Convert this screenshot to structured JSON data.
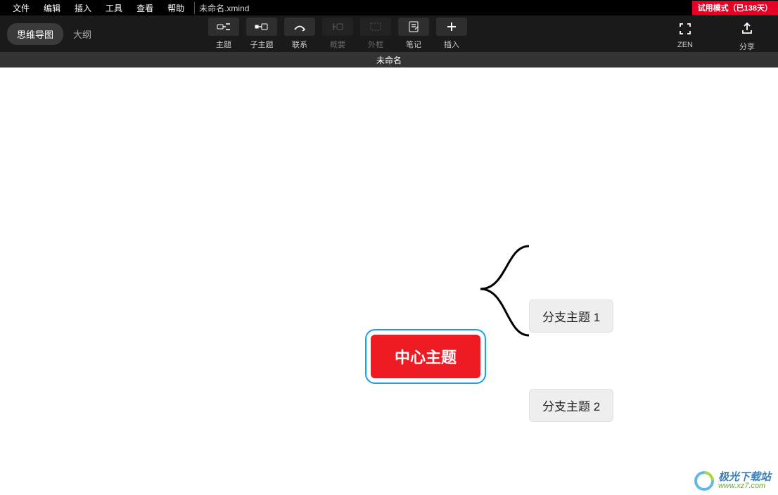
{
  "menu": {
    "file": "文件",
    "edit": "编辑",
    "insert": "插入",
    "tools": "工具",
    "view": "查看",
    "help": "帮助",
    "filename": "未命名.xmind",
    "trial": "试用模式（已138天）"
  },
  "views": {
    "mindmap": "思维导图",
    "outline": "大纲"
  },
  "tools": {
    "topic": "主题",
    "subtopic": "子主题",
    "relation": "联系",
    "summary": "概要",
    "boundary": "外框",
    "note": "笔记",
    "insert": "插入",
    "zen": "ZEN",
    "share": "分享"
  },
  "tab": {
    "name": "未命名"
  },
  "mindmap": {
    "central": "中心主题",
    "branch1": "分支主题 1",
    "branch2": "分支主题 2"
  },
  "watermark": {
    "main": "极光下载站",
    "sub": "www.xz7.com"
  }
}
